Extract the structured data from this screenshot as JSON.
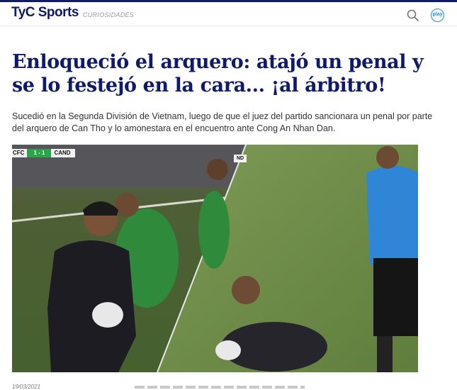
{
  "header": {
    "logo": "TyC Sports",
    "section": "CURIOSIDADES",
    "play_label": "play",
    "search_icon": "search-icon"
  },
  "article": {
    "headline": "Enloqueció el arquero: atajó un penal y se lo festejó en la cara... ¡al árbitro!",
    "lead": "Sucedió en la Segunda División de Vietnam, luego de que el juez del partido sancionara un penal por parte del arquero de Can Tho y lo amonestara en el encuentro ante Cong An Nhan Dan.",
    "date": "19/03/2021"
  },
  "video": {
    "scorebug_team1": "CFC",
    "scorebug_score": "1 - 1",
    "scorebug_team2": "CAND",
    "scorebug_team2_right": "ND"
  },
  "colors": {
    "brand": "#101a66",
    "accent": "#1c8ee0",
    "score_green": "#2aa34a"
  }
}
